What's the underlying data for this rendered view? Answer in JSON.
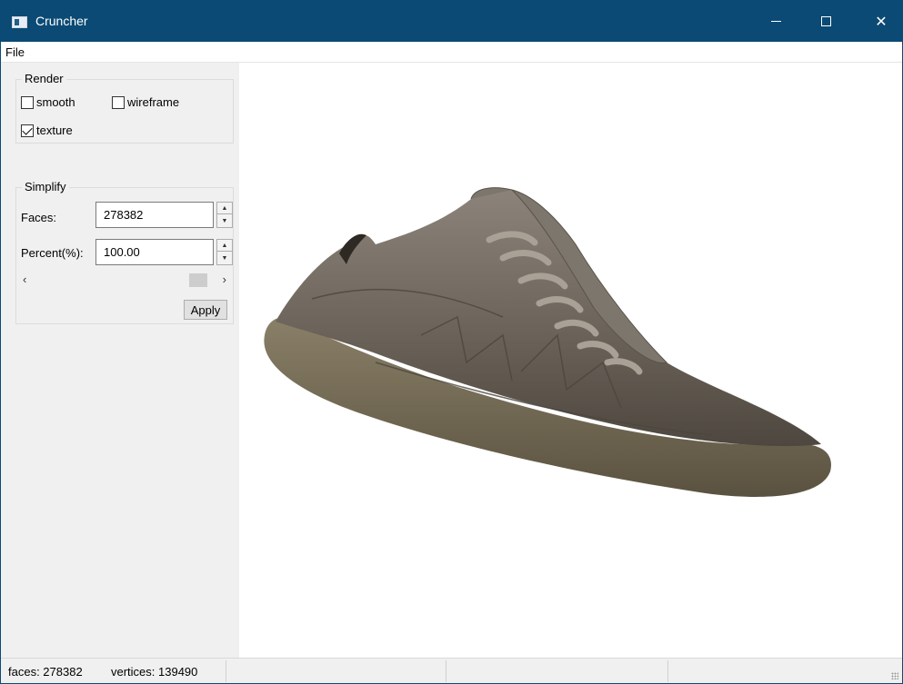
{
  "window": {
    "title": "Cruncher",
    "title_bar_color": "#0b4a74",
    "controls": {
      "minimize_icon": "minimize-icon",
      "maximize_icon": "maximize-icon",
      "close_icon": "close-icon",
      "close_glyph": "✕"
    }
  },
  "menu": {
    "file_label": "File"
  },
  "render": {
    "title": "Render",
    "smooth_label": "smooth",
    "smooth_checked": false,
    "wireframe_label": "wireframe",
    "wireframe_checked": false,
    "texture_label": "texture",
    "texture_checked": true
  },
  "simplify": {
    "title": "Simplify",
    "faces_label": "Faces:",
    "faces_value": "278382",
    "percent_label": "Percent(%):",
    "percent_value": "100.00",
    "scroll_left_glyph": "‹",
    "scroll_right_glyph": "›",
    "apply_label": "Apply"
  },
  "status": {
    "faces_text": "faces: 278382",
    "vertices_text": "vertices: 139490"
  }
}
